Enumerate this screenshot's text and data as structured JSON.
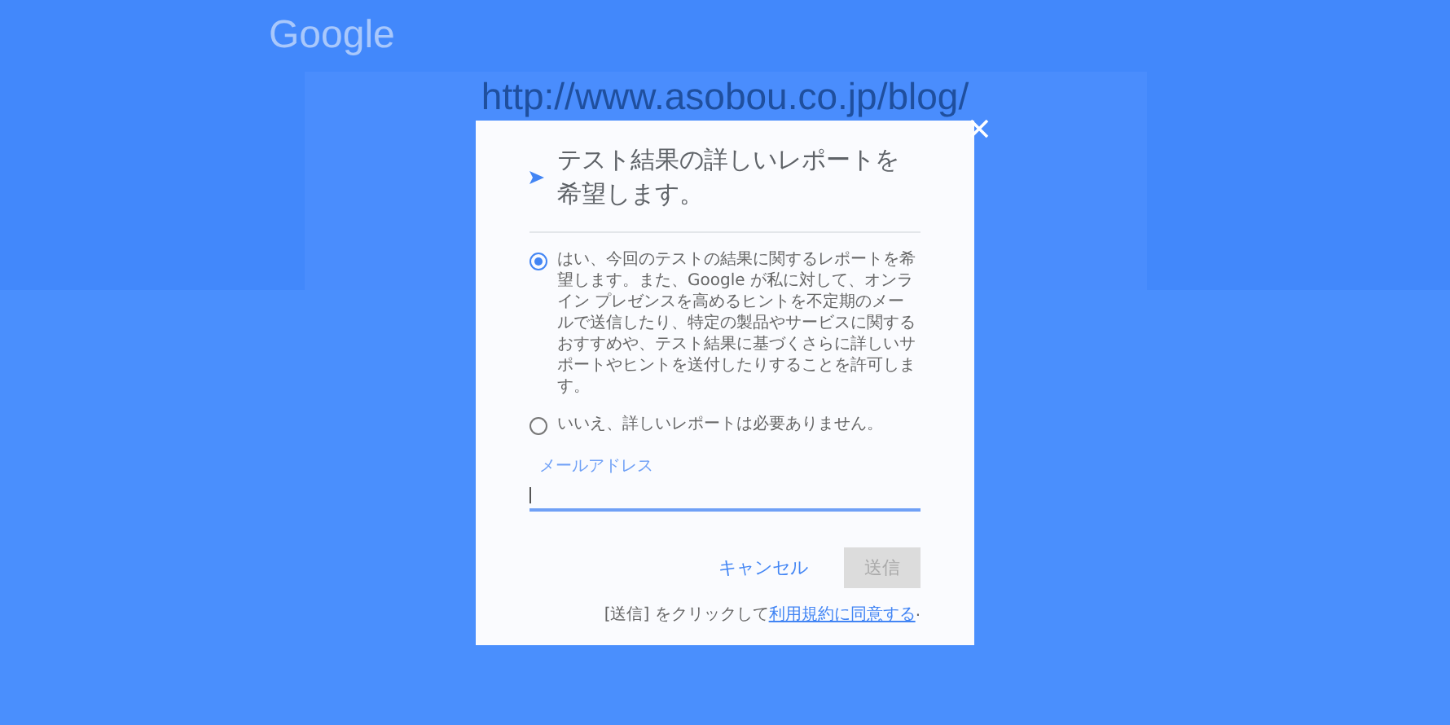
{
  "background": {
    "logo": "Google",
    "url": "http://www.asobou.co.jp/blog/"
  },
  "dialog": {
    "title": "テスト結果の詳しいレポートを希望します。",
    "options": [
      {
        "label": "はい、今回のテストの結果に関するレポートを希望します。また、Google が私に対して、オンライン プレゼンスを高めるヒントを不定期のメールで送信したり、特定の製品やサービスに関するおすすめや、テスト結果に基づくさらに詳しいサポートやヒントを送付したりすることを許可します。",
        "selected": true
      },
      {
        "label": "いいえ、詳しいレポートは必要ありません。",
        "selected": false
      }
    ],
    "email": {
      "label": "メールアドレス",
      "focused": true
    },
    "buttons": [
      {
        "label": "キャンセル",
        "kind": "text",
        "disabled": false
      },
      {
        "label": "送信",
        "kind": "raised",
        "disabled": true
      }
    ],
    "note": {
      "prefix": "[送信] をクリックして",
      "link": "利用規約に同意する",
      "suffix": "."
    }
  }
}
